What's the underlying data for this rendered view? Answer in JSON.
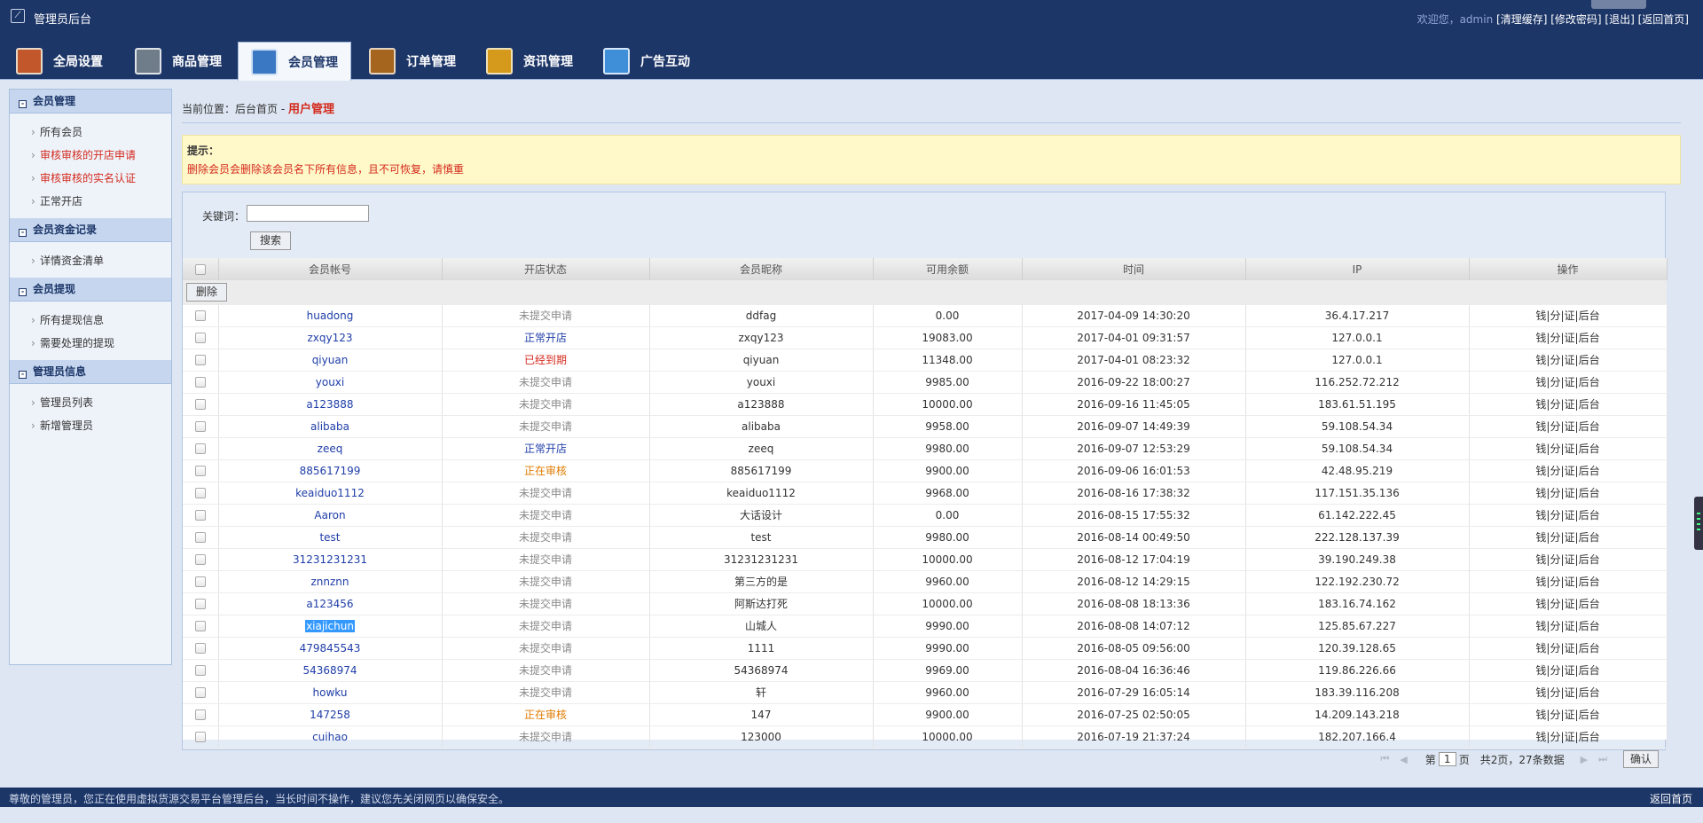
{
  "app": {
    "title": "管理员后台",
    "logo_icon": "logo-icon"
  },
  "top_links": {
    "welcome": "欢迎您，admin",
    "clear_cache": "[清理缓存]",
    "change_password": "[修改密码]",
    "logout": "[退出]",
    "home": "[返回首页]"
  },
  "tabs": [
    {
      "label": "全局设置",
      "icon": "shop-icon",
      "color": "#c1572b"
    },
    {
      "label": "商品管理",
      "icon": "grid-icon",
      "color": "#6f7c8a"
    },
    {
      "label": "会员管理",
      "icon": "member-icon",
      "color": "#3a78c3",
      "active": true
    },
    {
      "label": "订单管理",
      "icon": "wallet-icon",
      "color": "#a5651f"
    },
    {
      "label": "资讯管理",
      "icon": "book-icon",
      "color": "#d59a1c"
    },
    {
      "label": "广告互动",
      "icon": "window-icon",
      "color": "#3f8fd8"
    }
  ],
  "sidebar": {
    "sections": [
      {
        "title": "会员管理",
        "items": [
          {
            "label": "所有会员"
          },
          {
            "label": "审核审核的开店申请",
            "highlight": true
          },
          {
            "label": "审核审核的实名认证",
            "highlight": true
          },
          {
            "label": "正常开店"
          }
        ]
      },
      {
        "title": "会员资金记录",
        "items": [
          {
            "label": "详情资金清单"
          }
        ]
      },
      {
        "title": "会员提现",
        "items": [
          {
            "label": "所有提现信息"
          },
          {
            "label": "需要处理的提现"
          }
        ]
      },
      {
        "title": "管理员信息",
        "items": [
          {
            "label": "管理员列表"
          },
          {
            "label": "新增管理员"
          }
        ]
      }
    ]
  },
  "breadcrumb": {
    "prefix": "当前位置：",
    "home": "后台首页",
    "sep": " - ",
    "current": "用户管理"
  },
  "tip": {
    "title": "提示：",
    "message": "删除会员会删除该会员名下所有信息，且不可恢复，请慎重"
  },
  "search": {
    "label": "关键词：",
    "value": "",
    "button": "搜索"
  },
  "table": {
    "headers": [
      "会员帐号",
      "开店状态",
      "会员昵称",
      "可用余额",
      "时间",
      "IP",
      "操作"
    ],
    "delete_button": "删除",
    "ops": [
      "钱",
      "分",
      "证",
      "后台"
    ],
    "rows": [
      {
        "account": "huadong",
        "status": "未提交申请",
        "nickname": "ddfag",
        "balance": "0.00",
        "time": "2017-04-09 14:30:20",
        "ip": "36.4.17.217"
      },
      {
        "account": "zxqy123",
        "status": "正常开店",
        "nickname": "zxqy123",
        "balance": "19083.00",
        "time": "2017-04-01 09:31:57",
        "ip": "127.0.0.1"
      },
      {
        "account": "qiyuan",
        "status": "已经到期",
        "nickname": "qiyuan",
        "balance": "11348.00",
        "time": "2017-04-01 08:23:32",
        "ip": "127.0.0.1"
      },
      {
        "account": "youxi",
        "status": "未提交申请",
        "nickname": "youxi",
        "balance": "9985.00",
        "time": "2016-09-22 18:00:27",
        "ip": "116.252.72.212"
      },
      {
        "account": "a123888",
        "status": "未提交申请",
        "nickname": "a123888",
        "balance": "10000.00",
        "time": "2016-09-16 11:45:05",
        "ip": "183.61.51.195"
      },
      {
        "account": "alibaba",
        "status": "未提交申请",
        "nickname": "alibaba",
        "balance": "9958.00",
        "time": "2016-09-07 14:49:39",
        "ip": "59.108.54.34"
      },
      {
        "account": "zeeq",
        "status": "正常开店",
        "nickname": "zeeq",
        "balance": "9980.00",
        "time": "2016-09-07 12:53:29",
        "ip": "59.108.54.34"
      },
      {
        "account": "885617199",
        "status": "正在审核",
        "nickname": "885617199",
        "balance": "9900.00",
        "time": "2016-09-06 16:01:53",
        "ip": "42.48.95.219"
      },
      {
        "account": "keaiduo1112",
        "status": "未提交申请",
        "nickname": "keaiduo1112",
        "balance": "9968.00",
        "time": "2016-08-16 17:38:32",
        "ip": "117.151.35.136"
      },
      {
        "account": "Aaron",
        "status": "未提交申请",
        "nickname": "大话设计",
        "balance": "0.00",
        "time": "2016-08-15 17:55:32",
        "ip": "61.142.222.45"
      },
      {
        "account": "test",
        "status": "未提交申请",
        "nickname": "test",
        "balance": "9980.00",
        "time": "2016-08-14 00:49:50",
        "ip": "222.128.137.39"
      },
      {
        "account": "31231231231",
        "status": "未提交申请",
        "nickname": "31231231231",
        "balance": "10000.00",
        "time": "2016-08-12 17:04:19",
        "ip": "39.190.249.38"
      },
      {
        "account": "znnznn",
        "status": "未提交申请",
        "nickname": "第三方的是",
        "balance": "9960.00",
        "time": "2016-08-12 14:29:15",
        "ip": "122.192.230.72"
      },
      {
        "account": "a123456",
        "status": "未提交申请",
        "nickname": "阿斯达打死",
        "balance": "10000.00",
        "time": "2016-08-08 18:13:36",
        "ip": "183.16.74.162"
      },
      {
        "account": "xiajichun",
        "status": "未提交申请",
        "nickname": "山城人",
        "balance": "9990.00",
        "time": "2016-08-08 14:07:12",
        "ip": "125.85.67.227",
        "selected": true
      },
      {
        "account": "479845543",
        "status": "未提交申请",
        "nickname": "1111",
        "balance": "9990.00",
        "time": "2016-08-05 09:56:00",
        "ip": "120.39.128.65"
      },
      {
        "account": "54368974",
        "status": "未提交申请",
        "nickname": "54368974",
        "balance": "9969.00",
        "time": "2016-08-04 16:36:46",
        "ip": "119.86.226.66"
      },
      {
        "account": "howku",
        "status": "未提交申请",
        "nickname": "轩",
        "balance": "9960.00",
        "time": "2016-07-29 16:05:14",
        "ip": "183.39.116.208"
      },
      {
        "account": "147258",
        "status": "正在审核",
        "nickname": "147",
        "balance": "9900.00",
        "time": "2016-07-25 02:50:05",
        "ip": "14.209.143.218"
      },
      {
        "account": "cuihao",
        "status": "未提交申请",
        "nickname": "123000",
        "balance": "10000.00",
        "time": "2016-07-19 21:37:24",
        "ip": "182.207.166.4"
      }
    ]
  },
  "pager": {
    "first": "⏮",
    "prev": "◀",
    "page_prefix": "第",
    "page": "1",
    "page_suffix": "页",
    "total": "共2页，27条数据",
    "next": "▶",
    "last": "⏭",
    "confirm": "确认"
  },
  "footer": {
    "message": "尊敬的管理员，您正在使用虚拟货源交易平台管理后台，当长时间不操作，建议您先关闭网页以确保安全。",
    "back": "返回首页"
  }
}
